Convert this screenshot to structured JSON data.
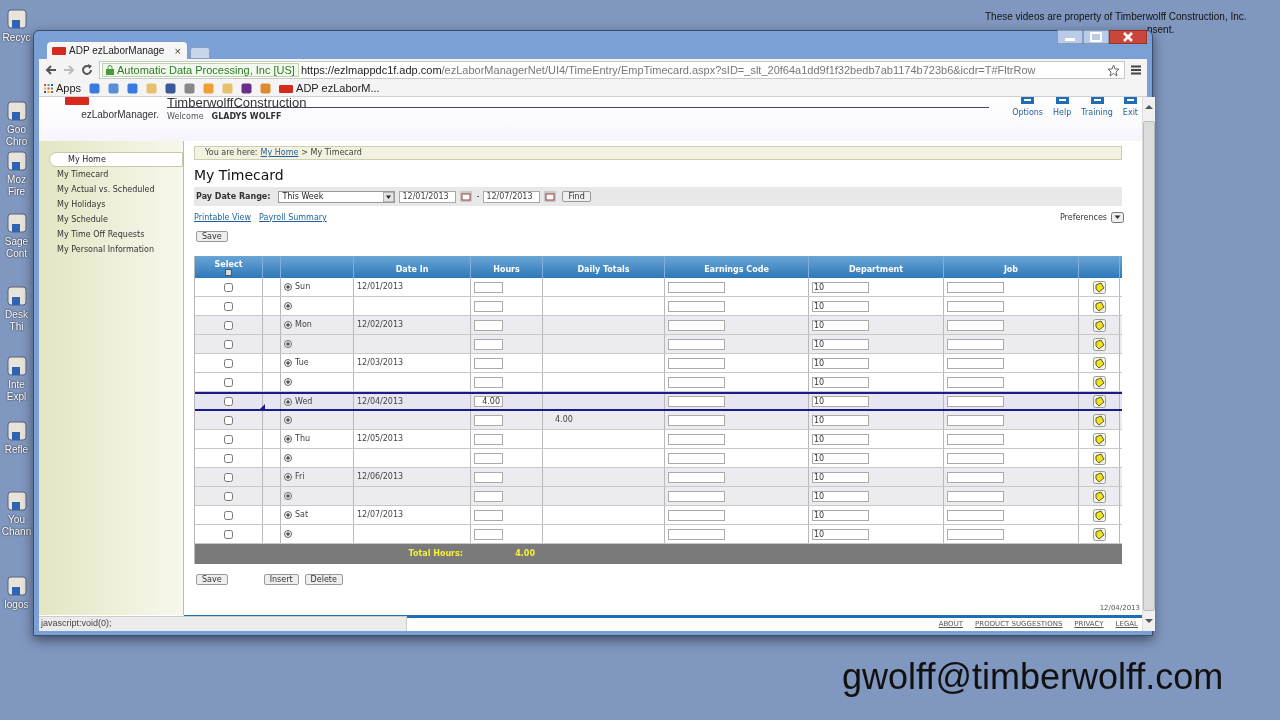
{
  "desktop_icons": [
    {
      "label": "Recyc"
    },
    {
      "label": "Goo Chro"
    },
    {
      "label": "Moz Fire"
    },
    {
      "label": "Sage Cont"
    },
    {
      "label": "Desk Thi"
    },
    {
      "label": "Inte Expl"
    },
    {
      "label": "Refle"
    },
    {
      "label": "You Chann"
    },
    {
      "label": "logos"
    }
  ],
  "overlay_notice": [
    "These videos are property of Timberwolff Construction, Inc.",
    "nsent."
  ],
  "email": "gwolff@timberwolff.com",
  "browser": {
    "tab_title": "ADP ezLaborManage",
    "tab_close": "×",
    "site_identity": "Automatic Data Processing, Inc [US]",
    "url_host": "https://ezlmappdc1f.adp.com",
    "url_path": "/ezLaborManagerNet/UI4/TimeEntry/EmpTimecard.aspx?sID=_slt_20f64a1dd9f1f32bedb7ab1174b723b6&icdr=T#FltrRow",
    "apps": "Apps",
    "bookmark": "ADP ezLaborM...",
    "status": "javascript:void(0);"
  },
  "header": {
    "logo": "ezLaborManager.",
    "company": "TimberwolffConstruction",
    "welcome": "Welcome",
    "user": "GLADYS WOLFF",
    "actions": [
      {
        "label": "Options"
      },
      {
        "label": "Help"
      },
      {
        "label": "Training"
      },
      {
        "label": "Exit"
      }
    ]
  },
  "sidebar": {
    "items": [
      {
        "label": "My Home",
        "selected": true
      },
      {
        "label": "My Timecard",
        "selected": false
      },
      {
        "label": "My Actual vs. Scheduled",
        "selected": false
      },
      {
        "label": "My Holidays",
        "selected": false
      },
      {
        "label": "My Schedule",
        "selected": false
      },
      {
        "label": "My Time Off Requests",
        "selected": false
      },
      {
        "label": "My Personal Information",
        "selected": false
      }
    ]
  },
  "breadcrumb": {
    "prefix": "You are here:",
    "link": "My Home",
    "current": "> My Timecard"
  },
  "title": "My Timecard",
  "filter": {
    "label": "Pay Date Range:",
    "range": "This Week",
    "start": "12/01/2013",
    "dash": "-",
    "end": "12/07/2013",
    "find": "Find"
  },
  "links": [
    "Printable View",
    "Payroll Summary"
  ],
  "preferences": "Preferences",
  "top_buttons": [
    "Save"
  ],
  "table": {
    "columns": [
      "Select",
      "Date In",
      "Hours",
      "Daily Totals",
      "Earnings Code",
      "Department",
      "Job"
    ],
    "rows": [
      {
        "day": "Sun",
        "date": "12/01/2013",
        "department": "10",
        "checked": false,
        "selected": false
      },
      {
        "department": "10",
        "checked": false,
        "selected": false
      },
      {
        "day": "Mon",
        "date": "12/02/2013",
        "department": "10",
        "checked": false,
        "selected": false
      },
      {
        "department": "10",
        "checked": false,
        "selected": false
      },
      {
        "day": "Tue",
        "date": "12/03/2013",
        "department": "10",
        "checked": false,
        "selected": false
      },
      {
        "department": "10",
        "checked": false,
        "selected": false
      },
      {
        "day": "Wed",
        "date": "12/04/2013",
        "hours": "4.00",
        "department": "10",
        "checked": false,
        "selected": true
      },
      {
        "daily_total": "4.00",
        "department": "10",
        "checked": false,
        "selected": false
      },
      {
        "day": "Thu",
        "date": "12/05/2013",
        "department": "10",
        "checked": false,
        "selected": false
      },
      {
        "department": "10",
        "checked": false,
        "selected": false
      },
      {
        "day": "Fri",
        "date": "12/06/2013",
        "department": "10",
        "checked": false,
        "selected": false
      },
      {
        "department": "10",
        "checked": false,
        "selected": false
      },
      {
        "day": "Sat",
        "date": "12/07/2013",
        "department": "10",
        "checked": false,
        "selected": false
      },
      {
        "department": "10",
        "checked": false,
        "selected": false
      }
    ],
    "select_all": {
      "checked": false
    },
    "total_label": "Total Hours:",
    "total_value": "4.00"
  },
  "bottom_buttons": [
    "Save",
    "Insert",
    "Delete"
  ],
  "footer": {
    "date": "12/04/2013",
    "links": [
      "ABOUT",
      "PRODUCT SUGGESTIONS",
      "PRIVACY",
      "LEGAL"
    ]
  }
}
